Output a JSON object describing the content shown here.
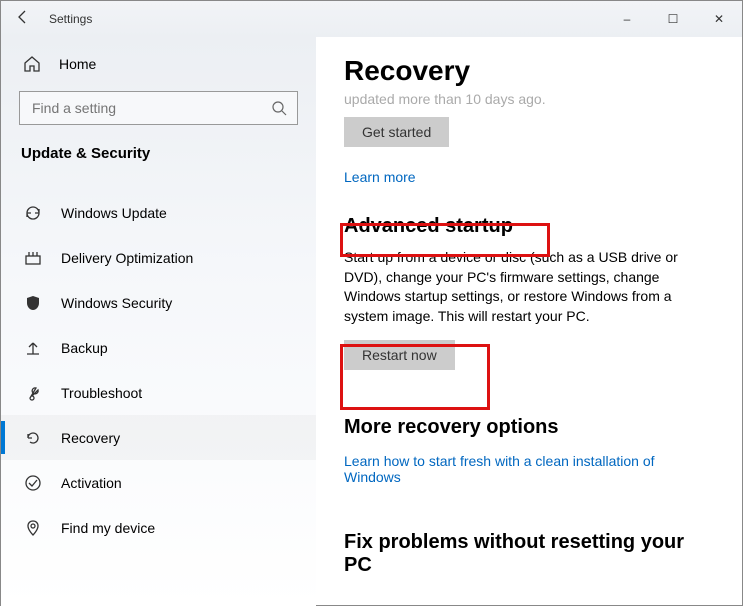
{
  "window": {
    "title": "Settings",
    "minimize": "–",
    "maximize": "☐",
    "close": "✕"
  },
  "sidebar": {
    "home": "Home",
    "search_placeholder": "Find a setting",
    "category": "Update & Security",
    "items": [
      {
        "label": "Windows Update"
      },
      {
        "label": "Delivery Optimization"
      },
      {
        "label": "Windows Security"
      },
      {
        "label": "Backup"
      },
      {
        "label": "Troubleshoot"
      },
      {
        "label": "Recovery"
      },
      {
        "label": "Activation"
      },
      {
        "label": "Find my device"
      }
    ]
  },
  "main": {
    "title": "Recovery",
    "scroll_hint": "updated more than 10 days ago.",
    "get_started": "Get started",
    "learn_more": "Learn more",
    "advanced": {
      "heading": "Advanced startup",
      "desc": "Start up from a device or disc (such as a USB drive or DVD), change your PC's firmware settings, change Windows startup settings, or restore Windows from a system image. This will restart your PC.",
      "button": "Restart now"
    },
    "more": {
      "heading": "More recovery options",
      "link": "Learn how to start fresh with a clean installation of Windows"
    },
    "fix": {
      "heading": "Fix problems without resetting your PC"
    }
  }
}
